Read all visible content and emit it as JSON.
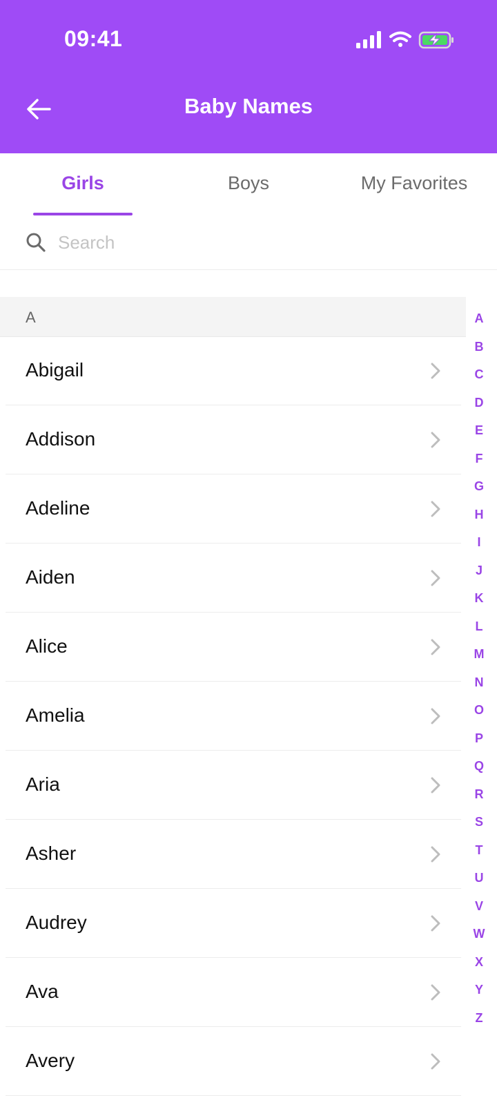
{
  "status_bar": {
    "time": "09:41"
  },
  "header": {
    "title": "Baby Names"
  },
  "tabs": [
    {
      "label": "Girls",
      "active": true
    },
    {
      "label": "Boys",
      "active": false
    },
    {
      "label": "My Favorites",
      "active": false
    }
  ],
  "search": {
    "placeholder": "Search",
    "value": ""
  },
  "section": {
    "letter": "A"
  },
  "names": [
    "Abigail",
    "Addison",
    "Adeline",
    "Aiden",
    "Alice",
    "Amelia",
    "Aria",
    "Asher",
    "Audrey",
    "Ava",
    "Avery"
  ],
  "index_letters": [
    "A",
    "B",
    "C",
    "D",
    "E",
    "F",
    "G",
    "H",
    "I",
    "J",
    "K",
    "L",
    "M",
    "N",
    "O",
    "P",
    "Q",
    "R",
    "S",
    "T",
    "U",
    "V",
    "W",
    "X",
    "Y",
    "Z"
  ],
  "colors": {
    "header_bg": "#9f4bf6",
    "accent": "#9a45e6",
    "battery_fill": "#4cd964"
  },
  "icons": {
    "back": "arrow-left-icon",
    "search": "search-icon",
    "row": "chevron-right-icon"
  }
}
